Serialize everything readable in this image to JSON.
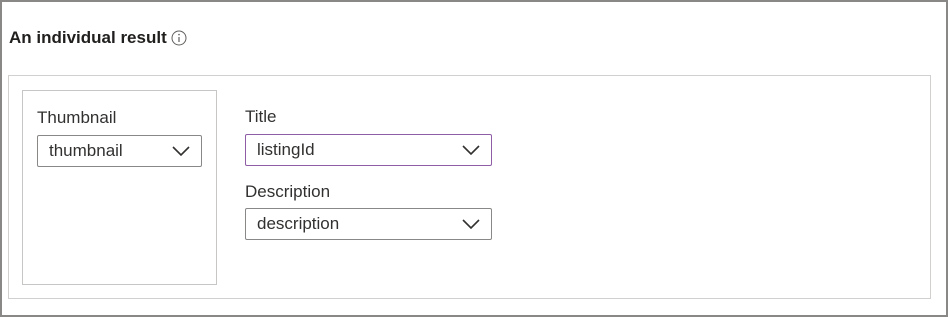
{
  "section": {
    "title": "An individual result",
    "info_icon": "info-icon"
  },
  "thumbnail": {
    "label": "Thumbnail",
    "value": "thumbnail",
    "icon": "chevron-down-icon"
  },
  "title_field": {
    "label": "Title",
    "value": "listingId",
    "icon": "chevron-down-icon"
  },
  "description_field": {
    "label": "Description",
    "value": "description",
    "icon": "chevron-down-icon"
  },
  "colors": {
    "focused_border": "#8e5da6",
    "border": "#8a8886",
    "text": "#323130"
  }
}
